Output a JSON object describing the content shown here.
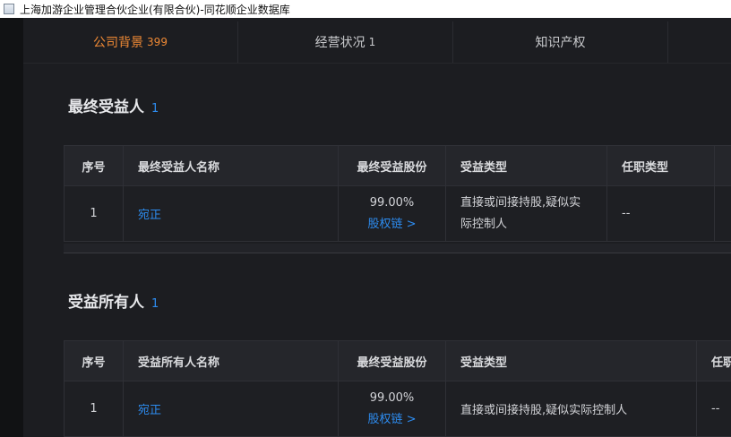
{
  "window": {
    "title": "上海加游企业管理合伙企业(有限合伙)-同花顺企业数据库"
  },
  "tabs": [
    {
      "label": "公司背景",
      "count": "399",
      "active": true
    },
    {
      "label": "经营状况",
      "count": "1",
      "active": false
    },
    {
      "label": "知识产权",
      "count": "",
      "active": false
    }
  ],
  "colors": {
    "accent": "#f08a35",
    "link": "#2d8cf0",
    "background": "#1c1d21"
  },
  "ultimate_beneficiary": {
    "title": "最终受益人",
    "count": "1",
    "columns": [
      "序号",
      "最终受益人名称",
      "最终受益股份",
      "受益类型",
      "任职类型"
    ],
    "rows": [
      {
        "index": "1",
        "name": "宛正",
        "share": "99.00%",
        "chain_link": "股权链 >",
        "type": "直接或间接持股,疑似实际控制人",
        "position": "--"
      }
    ]
  },
  "beneficial_owner": {
    "title": "受益所有人",
    "count": "1",
    "columns": [
      "序号",
      "受益所有人名称",
      "最终受益股份",
      "受益类型",
      "任职"
    ],
    "rows": [
      {
        "index": "1",
        "name": "宛正",
        "share": "99.00%",
        "chain_link": "股权链 >",
        "type": "直接或间接持股,疑似实际控制人",
        "position": "--"
      }
    ]
  }
}
